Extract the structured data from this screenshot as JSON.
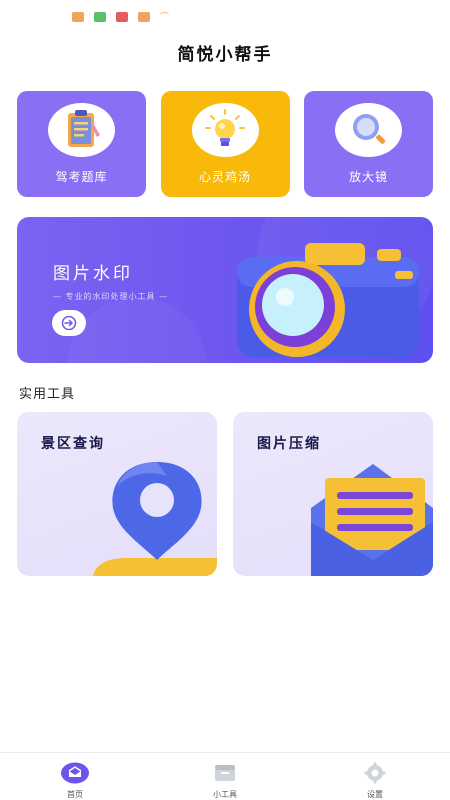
{
  "app": {
    "title": "简悦小帮手"
  },
  "status_bar": {
    "icons": [
      "app-icon-orange",
      "message-icon-green",
      "tiktok-icon-red",
      "app-icon-orange-2",
      "wifi-icon"
    ]
  },
  "top_cards": [
    {
      "label": "驾考题库",
      "icon": "clipboard-icon",
      "color": "#8a6ff5"
    },
    {
      "label": "心灵鸡汤",
      "icon": "lightbulb-icon",
      "color": "#f8b90a"
    },
    {
      "label": "放大镜",
      "icon": "magnifier-icon",
      "color": "#8a6ff5"
    }
  ],
  "banner": {
    "title": "图片水印",
    "subtitle": "— 专业的水印处理小工具 —",
    "icon": "camera-icon"
  },
  "section": {
    "title": "实用工具"
  },
  "tools": [
    {
      "title": "景区查询",
      "icon": "location-pin-icon"
    },
    {
      "title": "图片压缩",
      "icon": "envelope-icon"
    }
  ],
  "bottom_nav": [
    {
      "label": "首页",
      "icon": "home-icon",
      "active": true
    },
    {
      "label": "小工具",
      "icon": "toolbox-icon",
      "active": false
    },
    {
      "label": "设置",
      "icon": "gear-icon",
      "active": false
    }
  ],
  "colors": {
    "accent_purple": "#7c63f2",
    "accent_yellow": "#f8b90a",
    "tool_card_bg": "#e9e4fb"
  }
}
